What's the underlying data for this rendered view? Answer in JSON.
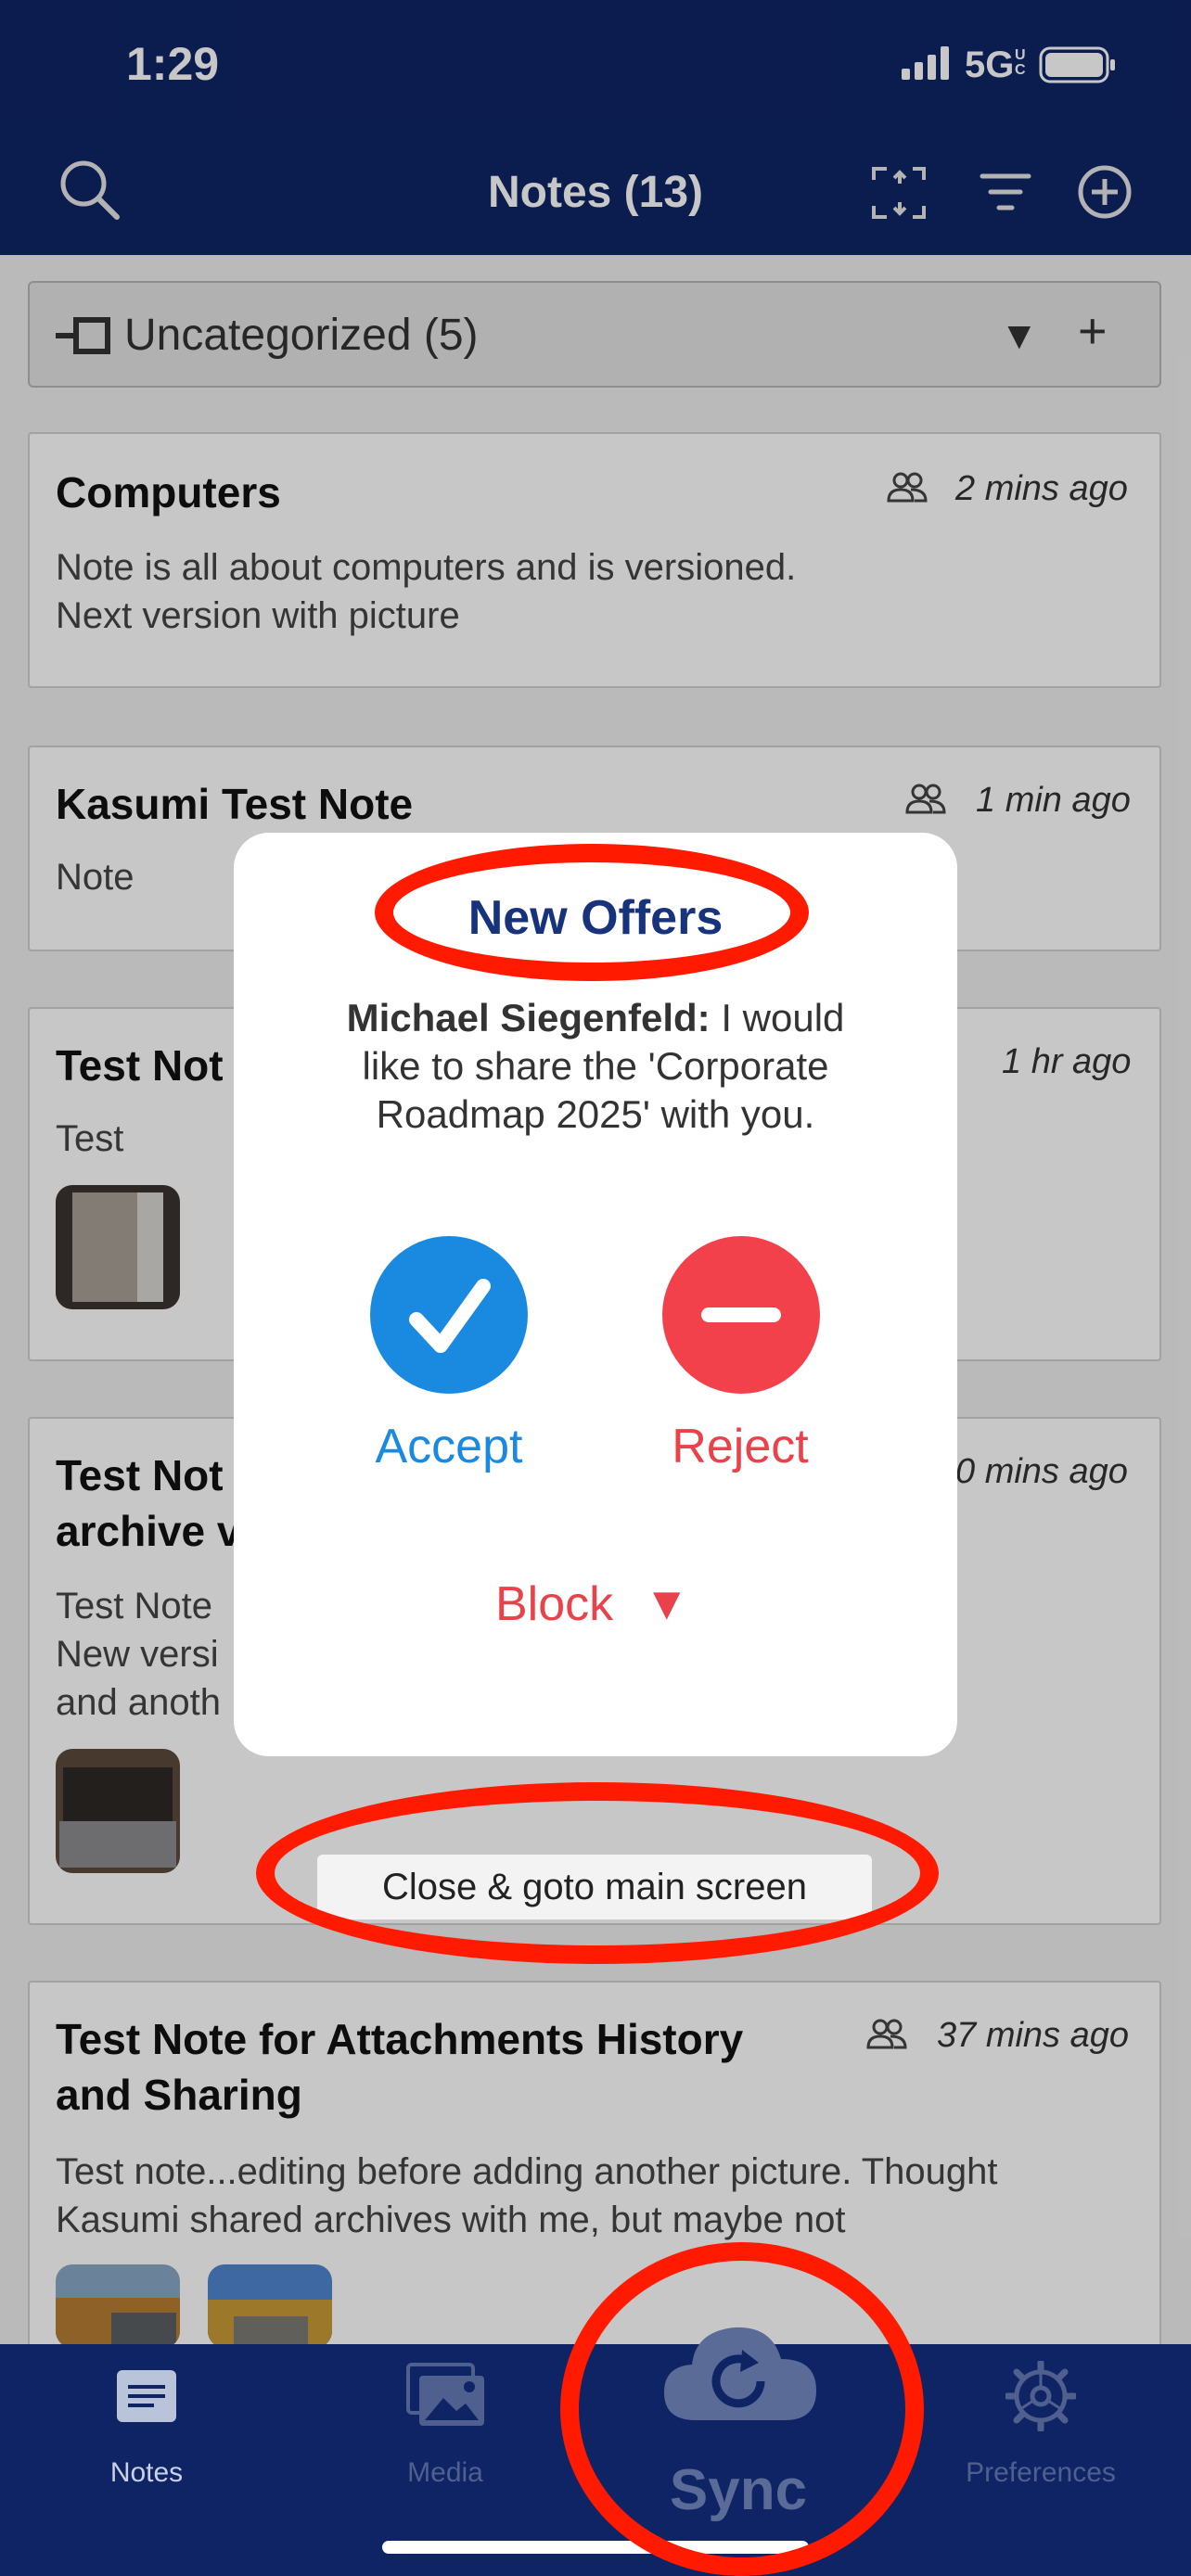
{
  "status_bar": {
    "time": "1:29",
    "network": "5G",
    "network_suffix": "UC"
  },
  "nav": {
    "title": "Notes (13)"
  },
  "category": {
    "label": "Uncategorized (5)"
  },
  "notes": [
    {
      "title": "Computers",
      "time": "2 mins ago",
      "body_lines": [
        "Note is all about computers and is versioned.",
        "Next version with picture"
      ]
    },
    {
      "title": "Kasumi Test Note",
      "time": "1 min ago",
      "body_lines": [
        "Note"
      ]
    },
    {
      "title": "Test Not",
      "time": "1 hr ago",
      "body_lines": [
        "Test"
      ]
    },
    {
      "title_lines": [
        "Test Not",
        "archive v"
      ],
      "time": "0 mins ago",
      "body_lines": [
        "Test Note",
        "New versi",
        "and anoth"
      ]
    },
    {
      "title_lines": [
        "Test Note for Attachments History",
        "and Sharing"
      ],
      "time": "37 mins ago",
      "body_lines": [
        "Test note...editing before adding another picture. Thought",
        "Kasumi shared archives with me, but maybe not"
      ]
    }
  ],
  "popup": {
    "title": "New Offers",
    "sender": "Michael Siegenfeld:",
    "message_lines": [
      " I would",
      "like to share the 'Corporate",
      "Roadmap 2025' with you."
    ],
    "accept_label": "Accept",
    "reject_label": "Reject",
    "block_label": "Block"
  },
  "close_button": {
    "label": "Close & goto main screen"
  },
  "tabs": [
    {
      "label": "Notes"
    },
    {
      "label": "Media"
    },
    {
      "label": "Sync"
    },
    {
      "label": "Preferences"
    }
  ],
  "colors": {
    "nav_bg": "#0f2464",
    "accent_blue": "#1a8ae0",
    "reject_red": "#f2414a",
    "annotation_red": "#ff1a00",
    "title_blue": "#16337c"
  },
  "icons": [
    "search-icon",
    "scan-icon",
    "filter-icon",
    "add-circle-icon",
    "category-icon",
    "dropdown-icon",
    "plus-icon",
    "shared-users-icon",
    "checkmark-icon",
    "minus-icon",
    "notes-tab-icon",
    "media-tab-icon",
    "sync-cloud-icon",
    "gear-icon"
  ]
}
